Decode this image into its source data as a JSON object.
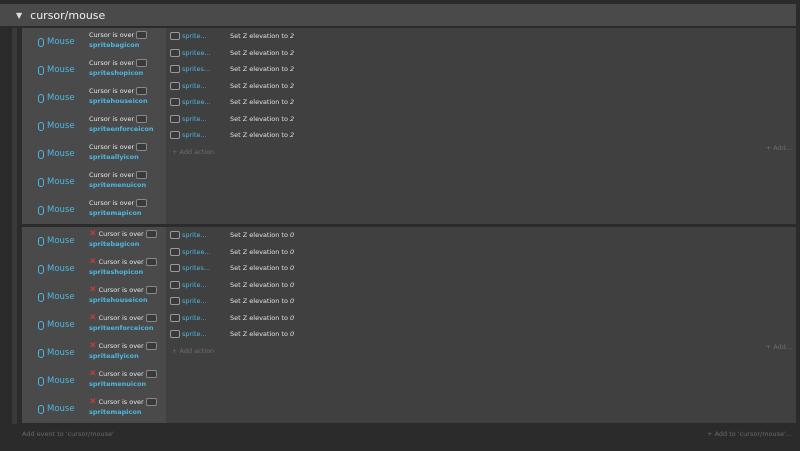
{
  "group": {
    "title": "cursor/mouse"
  },
  "common": {
    "mouse_label": "Mouse",
    "cursor_text": "Cursor is over",
    "add_action": "Add action",
    "add_right": "Add..."
  },
  "objects": [
    "spritebagicon",
    "spriteshopicon",
    "spritehouseicon",
    "spriteenforceicon",
    "spriteallyicon",
    "spritemenuicon",
    "spritemapicon"
  ],
  "actions_a": [
    {
      "obj": "sprite...",
      "text": "Set Z elevation to",
      "value": "2"
    },
    {
      "obj": "spritee...",
      "text": "Set Z elevation to",
      "value": "2"
    },
    {
      "obj": "sprites...",
      "text": "Set Z elevation to",
      "value": "2"
    },
    {
      "obj": "sprite...",
      "text": "Set Z elevation to",
      "value": "2"
    },
    {
      "obj": "spritee...",
      "text": "Set Z elevation to",
      "value": "2"
    },
    {
      "obj": "sprite...",
      "text": "Set Z elevation to",
      "value": "2"
    },
    {
      "obj": "sprite...",
      "text": "Set Z elevation to",
      "value": "2"
    }
  ],
  "actions_b": [
    {
      "obj": "sprite...",
      "text": "Set Z elevation to",
      "value": "0"
    },
    {
      "obj": "spritee...",
      "text": "Set Z elevation to",
      "value": "0"
    },
    {
      "obj": "sprites...",
      "text": "Set Z elevation to",
      "value": "0"
    },
    {
      "obj": "sprite...",
      "text": "Set Z elevation to",
      "value": "0"
    },
    {
      "obj": "sprite...",
      "text": "Set Z elevation to",
      "value": "0"
    },
    {
      "obj": "sprite...",
      "text": "Set Z elevation to",
      "value": "0"
    },
    {
      "obj": "sprite...",
      "text": "Set Z elevation to",
      "value": "0"
    }
  ],
  "footer": {
    "add_event": "Add event to 'cursor/mouse'",
    "add_to": "Add to 'cursor/mouse'..."
  },
  "colors": {
    "accent": "#4fb6e0",
    "negate": "#e53935",
    "header": "#4a4a4a"
  }
}
